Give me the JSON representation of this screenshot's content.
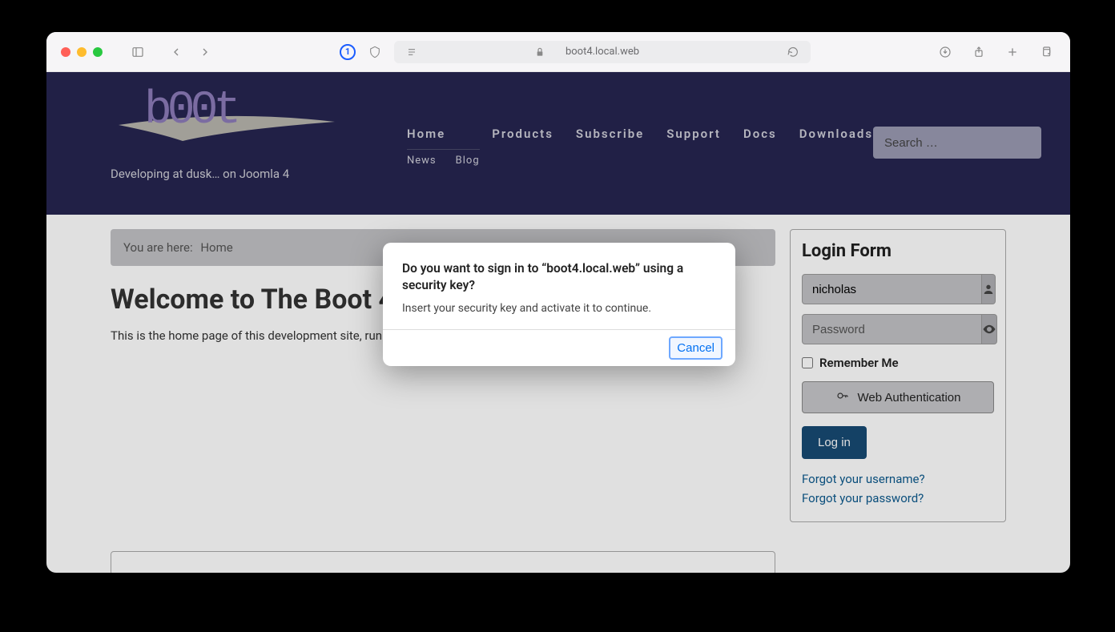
{
  "browser": {
    "address": "boot4.local.web"
  },
  "header": {
    "logo_text": "b00t",
    "tagline": "Developing at dusk… on Joomla 4",
    "nav": [
      "Home",
      "Products",
      "Subscribe",
      "Support",
      "Docs",
      "Downloads"
    ],
    "subnav": [
      "News",
      "Blog"
    ],
    "search_placeholder": "Search …"
  },
  "breadcrumb": {
    "label": "You are here:",
    "current": "Home"
  },
  "content": {
    "title": "Welcome to The Boot 4",
    "body": "This is the home page of this development site, runnin"
  },
  "login": {
    "title": "Login Form",
    "username_value": "nicholas",
    "password_placeholder": "Password",
    "remember_label": "Remember Me",
    "webauth_label": "Web Authentication",
    "login_label": "Log in",
    "forgot_username": "Forgot your username?",
    "forgot_password": "Forgot your password?"
  },
  "modal": {
    "title": "Do you want to sign in to “boot4.local.web” using a security key?",
    "text": "Insert your security key and activate it to continue.",
    "cancel_label": "Cancel"
  }
}
